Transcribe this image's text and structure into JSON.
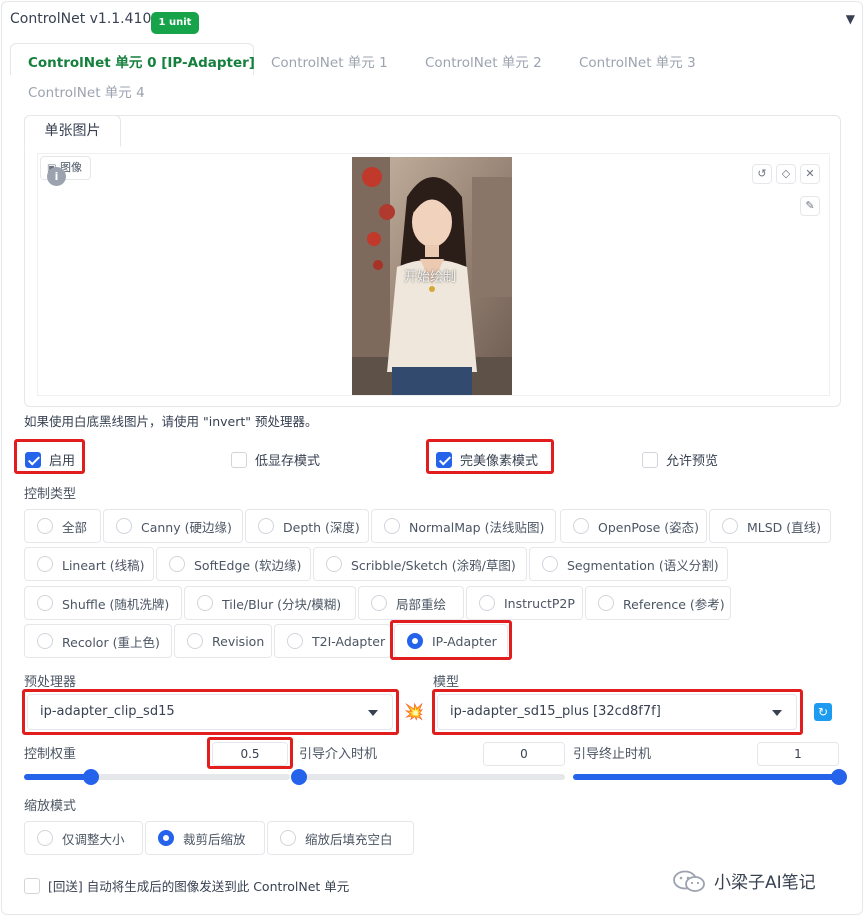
{
  "header": {
    "title": "ControlNet v1.1.410",
    "badge": "1 unit"
  },
  "tabs": [
    {
      "label": "ControlNet 单元 0 [IP-Adapter]",
      "active": true
    },
    {
      "label": "ControlNet 单元 1",
      "active": false
    },
    {
      "label": "ControlNet 单元 2",
      "active": false
    },
    {
      "label": "ControlNet 单元 3",
      "active": false
    },
    {
      "label": "ControlNet 单元 4",
      "active": false
    }
  ],
  "image_panel": {
    "tab": "单张图片",
    "label": "图像",
    "overlay_text": "开始绘制"
  },
  "hint": "如果使用白底黑线图片，请使用 \"invert\" 预处理器。",
  "options": {
    "enable": {
      "label": "启用",
      "checked": true
    },
    "low_vram": {
      "label": "低显存模式",
      "checked": false
    },
    "pixel_perfect": {
      "label": "完美像素模式",
      "checked": true
    },
    "allow_preview": {
      "label": "允许预览",
      "checked": false
    }
  },
  "control_type": {
    "label": "控制类型",
    "items": [
      "全部",
      "Canny (硬边缘)",
      "Depth (深度)",
      "NormalMap (法线贴图)",
      "OpenPose (姿态)",
      "MLSD (直线)",
      "Lineart (线稿)",
      "SoftEdge (软边缘)",
      "Scribble/Sketch (涂鸦/草图)",
      "Segmentation (语义分割)",
      "Shuffle (随机洗牌)",
      "Tile/Blur (分块/模糊)",
      "局部重绘",
      "InstructP2P",
      "Reference (参考)",
      "Recolor (重上色)",
      "Revision",
      "T2I-Adapter",
      "IP-Adapter"
    ],
    "selected": "IP-Adapter"
  },
  "preprocessor": {
    "label": "预处理器",
    "value": "ip-adapter_clip_sd15"
  },
  "model": {
    "label": "模型",
    "value": "ip-adapter_sd15_plus [32cd8f7f]"
  },
  "weight": {
    "label": "控制权重",
    "value": "0.5",
    "fraction": 0.25
  },
  "start": {
    "label": "引导介入时机",
    "value": "0",
    "fraction": 0
  },
  "end": {
    "label": "引导终止时机",
    "value": "1",
    "fraction": 1
  },
  "resize_mode": {
    "label": "缩放模式",
    "items": [
      "仅调整大小",
      "裁剪后缩放",
      "缩放后填充空白"
    ],
    "selected": "裁剪后缩放"
  },
  "loopback": {
    "label": "[回送] 自动将生成后的图像发送到此 ControlNet 单元",
    "checked": false
  },
  "watermark": "小梁子AI笔记",
  "colors": {
    "accent": "#2563eb",
    "green": "#16a34a",
    "highlight": "#e11d1d"
  }
}
